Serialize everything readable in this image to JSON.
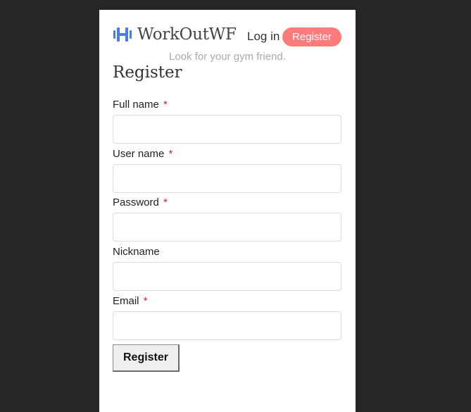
{
  "brand": {
    "name": "WorkOutWF",
    "icon": "dumbbell-icon",
    "color": "#4a7fd6"
  },
  "nav": {
    "login_label": "Log in",
    "register_label": "Register",
    "register_color": "#ff7b7b"
  },
  "tagline": "Look for your gym friend.",
  "page_title": "Register",
  "form": {
    "fields": [
      {
        "label": "Full name",
        "required": true,
        "value": "",
        "required_mark": "*"
      },
      {
        "label": "User name",
        "required": true,
        "value": "",
        "required_mark": "*"
      },
      {
        "label": "Password",
        "required": true,
        "value": "",
        "required_mark": "*"
      },
      {
        "label": "Nickname",
        "required": false,
        "value": "",
        "required_mark": ""
      },
      {
        "label": "Email",
        "required": true,
        "value": "",
        "required_mark": "*"
      }
    ],
    "submit_label": "Register"
  }
}
